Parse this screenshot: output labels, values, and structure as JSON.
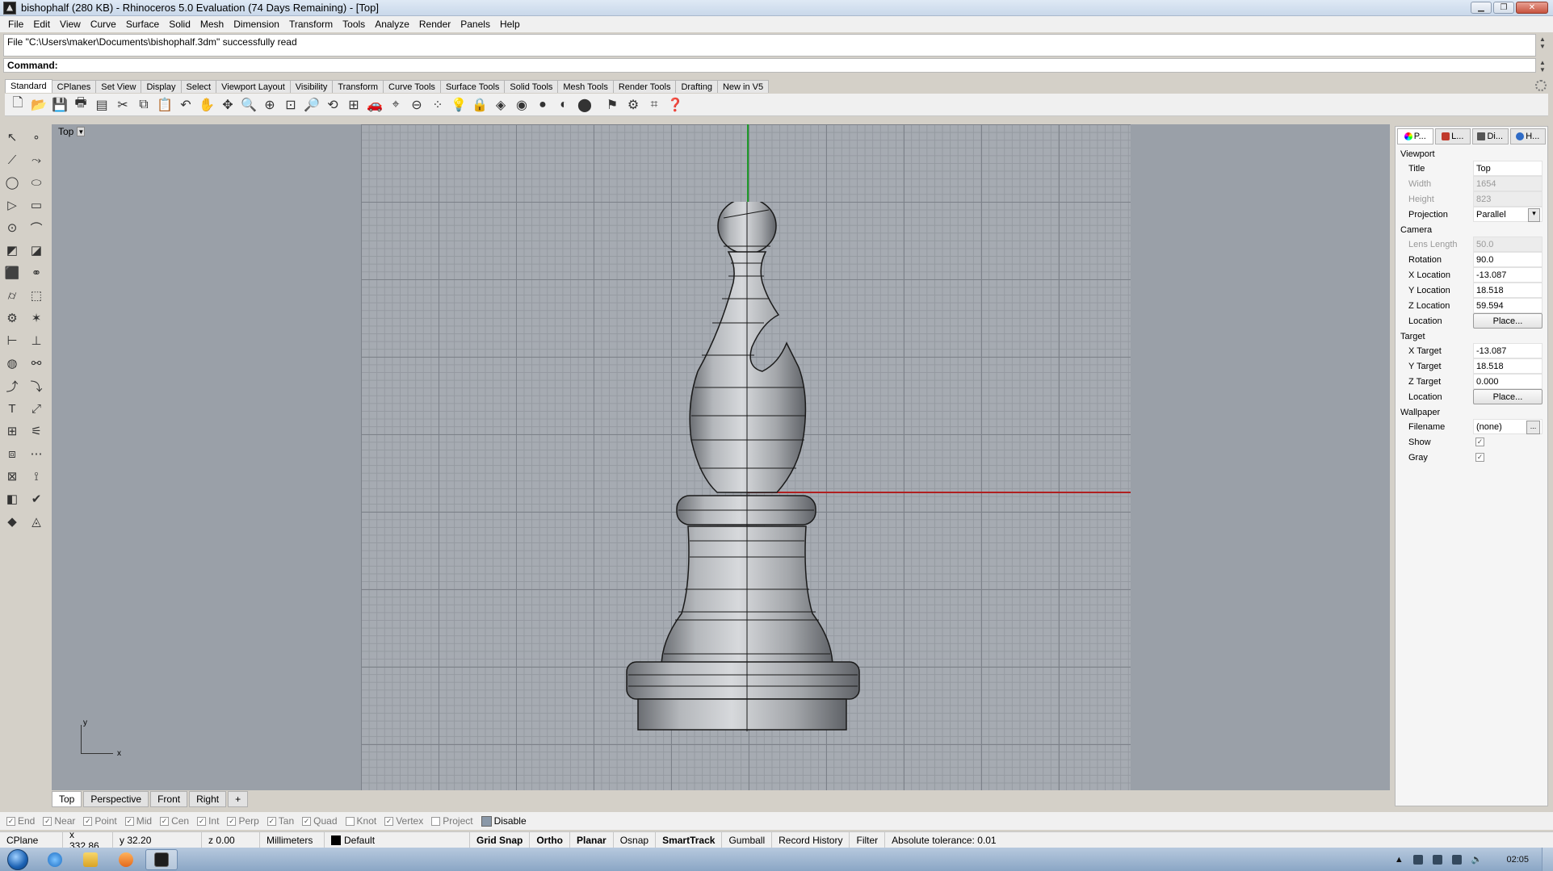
{
  "window": {
    "title": "bishophalf (280 KB) - Rhinoceros 5.0 Evaluation (74 Days Remaining) - [Top]"
  },
  "menu": [
    "File",
    "Edit",
    "View",
    "Curve",
    "Surface",
    "Solid",
    "Mesh",
    "Dimension",
    "Transform",
    "Tools",
    "Analyze",
    "Render",
    "Panels",
    "Help"
  ],
  "command": {
    "history": "File \"C:\\Users\\maker\\Documents\\bishophalf.3dm\" successfully read",
    "prompt": "Command:"
  },
  "toolbar_tabs": [
    "Standard",
    "CPlanes",
    "Set View",
    "Display",
    "Select",
    "Viewport Layout",
    "Visibility",
    "Transform",
    "Curve Tools",
    "Surface Tools",
    "Solid Tools",
    "Mesh Tools",
    "Render Tools",
    "Drafting",
    "New in V5"
  ],
  "viewport": {
    "label": "Top",
    "axis_x": "x",
    "axis_y": "y"
  },
  "viewport_tabs": [
    "Top",
    "Perspective",
    "Front",
    "Right",
    "+"
  ],
  "osnap": {
    "items": [
      {
        "label": "End",
        "checked": true
      },
      {
        "label": "Near",
        "checked": true
      },
      {
        "label": "Point",
        "checked": true
      },
      {
        "label": "Mid",
        "checked": true
      },
      {
        "label": "Cen",
        "checked": true
      },
      {
        "label": "Int",
        "checked": true
      },
      {
        "label": "Perp",
        "checked": true
      },
      {
        "label": "Tan",
        "checked": true
      },
      {
        "label": "Quad",
        "checked": true
      },
      {
        "label": "Knot",
        "checked": false
      },
      {
        "label": "Vertex",
        "checked": true
      },
      {
        "label": "Project",
        "checked": false
      }
    ],
    "disable_label": "Disable"
  },
  "status": {
    "cplane": "CPlane",
    "x": "x 332.86",
    "y": "y 32.20",
    "z": "z 0.00",
    "units": "Millimeters",
    "layer": "Default",
    "grid_snap": "Grid Snap",
    "ortho": "Ortho",
    "planar": "Planar",
    "osnap": "Osnap",
    "smarttrack": "SmartTrack",
    "gumball": "Gumball",
    "record_history": "Record History",
    "filter": "Filter",
    "tolerance": "Absolute tolerance: 0.01"
  },
  "panel": {
    "tabs": [
      "P...",
      "L...",
      "Di...",
      "H..."
    ],
    "viewport_section": "Viewport",
    "title_label": "Title",
    "title_value": "Top",
    "width_label": "Width",
    "width_value": "1654",
    "height_label": "Height",
    "height_value": "823",
    "projection_label": "Projection",
    "projection_value": "Parallel",
    "camera_section": "Camera",
    "lens_label": "Lens Length",
    "lens_value": "50.0",
    "rotation_label": "Rotation",
    "rotation_value": "90.0",
    "xloc_label": "X Location",
    "xloc_value": "-13.087",
    "yloc_label": "Y Location",
    "yloc_value": "18.518",
    "zloc_label": "Z Location",
    "zloc_value": "59.594",
    "location_label": "Location",
    "place_button": "Place...",
    "target_section": "Target",
    "xtarget_label": "X Target",
    "xtarget_value": "-13.087",
    "ytarget_label": "Y Target",
    "ytarget_value": "18.518",
    "ztarget_label": "Z Target",
    "ztarget_value": "0.000",
    "target_location_label": "Location",
    "target_place_button": "Place...",
    "wallpaper_section": "Wallpaper",
    "filename_label": "Filename",
    "filename_value": "(none)",
    "show_label": "Show",
    "gray_label": "Gray"
  },
  "taskbar": {
    "clock": "02:05"
  }
}
